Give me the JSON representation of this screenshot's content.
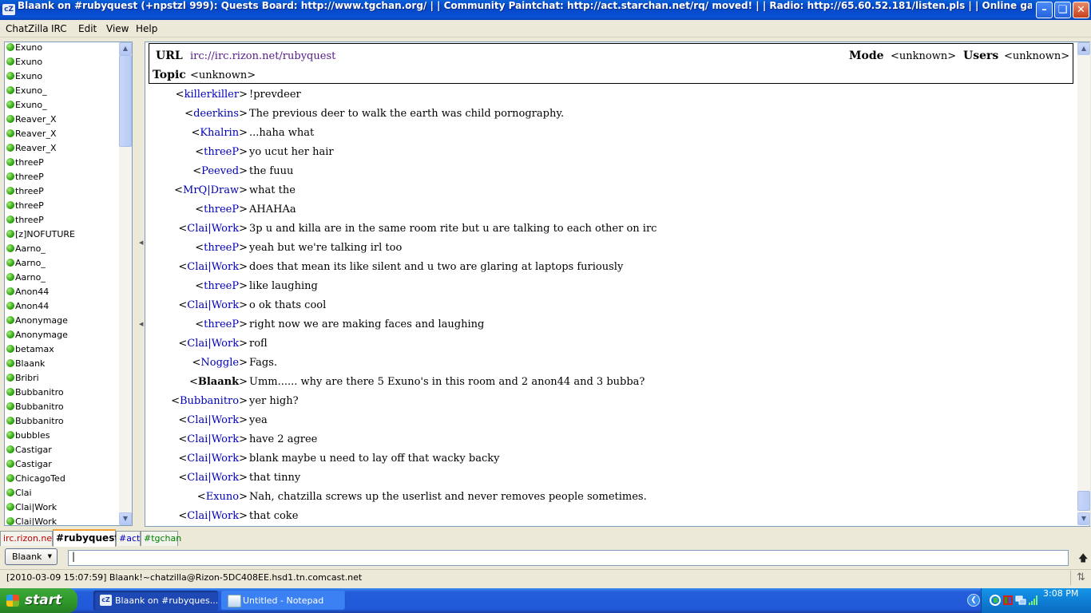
{
  "window": {
    "title": "Blaank on #rubyquest (+npstzl 999): Quests Board: http://www.tgchan.org/ | | Community Paintchat: http://act.starchan.net/rq/ moved! | | Radio: http://65.60.52.181/listen.pls | | Online game: #metal...",
    "app_icon": "cZ"
  },
  "menu": [
    "ChatZilla",
    "IRC",
    "Edit",
    "View",
    "Help"
  ],
  "userlist": [
    "Exuno",
    "Exuno",
    "Exuno",
    "Exuno_",
    "Exuno_",
    "Reaver_X",
    "Reaver_X",
    "Reaver_X",
    "threeP",
    "threeP",
    "threeP",
    "threeP",
    "threeP",
    "[z]NOFUTURE",
    "Aarno_",
    "Aarno_",
    "Aarno_",
    "Anon44",
    "Anon44",
    "Anonymage",
    "Anonymage",
    "betamax",
    "Blaank",
    "Bribri",
    "Bubbanitro",
    "Bubbanitro",
    "Bubbanitro",
    "bubbles",
    "Castigar",
    "Castigar",
    "ChicagoTed",
    "Clai",
    "Clai|Work",
    "Clai|Work"
  ],
  "header": {
    "url_label": "URL",
    "url_value": "irc://irc.rizon.net/rubyquest",
    "mode_label": "Mode",
    "mode_value": "<unknown>",
    "users_label": "Users",
    "users_value": "<unknown>",
    "topic_label": "Topic",
    "topic_value": "<unknown>"
  },
  "messages": [
    {
      "nick": "killerkiller",
      "text": "!prevdeer"
    },
    {
      "nick": "deerkins",
      "text": "The previous deer to walk the earth was child pornography."
    },
    {
      "nick": "Khalrin",
      "text": "...haha what"
    },
    {
      "nick": "threeP",
      "text": "yo ucut her hair"
    },
    {
      "nick": "Peeved",
      "text": "the fuuu"
    },
    {
      "nick": "MrQ|Draw",
      "text": "what the"
    },
    {
      "nick": "threeP",
      "text": "AHAHAa"
    },
    {
      "nick": "Clai|Work",
      "text": "3p u and killa are in the same room rite but u are talking to each other on irc"
    },
    {
      "nick": "threeP",
      "text": "yeah but we're talking irl too"
    },
    {
      "nick": "Clai|Work",
      "text": "does that mean its like silent and u two are glaring at laptops furiously"
    },
    {
      "nick": "threeP",
      "text": "like laughing"
    },
    {
      "nick": "Clai|Work",
      "text": "o ok thats cool"
    },
    {
      "nick": "threeP",
      "text": "right now we are making faces and laughing"
    },
    {
      "nick": "Clai|Work",
      "text": "rofl"
    },
    {
      "nick": "Noggle",
      "text": "Fags."
    },
    {
      "nick": "Blaank",
      "text": "Umm...... why are there 5 Exuno's in this room  and 2 anon44 and 3 bubba?",
      "self": true
    },
    {
      "nick": "Bubbanitro",
      "text": "yer high?"
    },
    {
      "nick": "Clai|Work",
      "text": "yea"
    },
    {
      "nick": "Clai|Work",
      "text": "have 2 agree"
    },
    {
      "nick": "Clai|Work",
      "text": "blank maybe u need to lay off that wacky backy"
    },
    {
      "nick": "Clai|Work",
      "text": "that tinny"
    },
    {
      "nick": "Exuno",
      "text": "Nah, chatzilla screws up the userlist and never removes people sometimes."
    },
    {
      "nick": "Clai|Work",
      "text": "that coke"
    }
  ],
  "tabs": [
    {
      "label": "irc.rizon.net",
      "color": "#c00000",
      "active": false
    },
    {
      "label": "#rubyquest",
      "color": "#000000",
      "active": true
    },
    {
      "label": "#act",
      "color": "#0000c0",
      "active": false
    },
    {
      "label": "#tgchan",
      "color": "#008000",
      "active": false
    }
  ],
  "input": {
    "nick_button": "Blaank",
    "value": "|"
  },
  "status": {
    "text": "[2010-03-09 15:07:59] Blaank!~chatzilla@Rizon-5DC408EE.hsd1.tn.comcast.net"
  },
  "taskbar": {
    "start_label": "start",
    "tasks": [
      {
        "label": "Blaank on #rubyques...",
        "icon": "cZ",
        "active": true
      },
      {
        "label": "Untitled - Notepad",
        "icon": "",
        "active": false
      }
    ],
    "clock": "3:08 PM"
  }
}
